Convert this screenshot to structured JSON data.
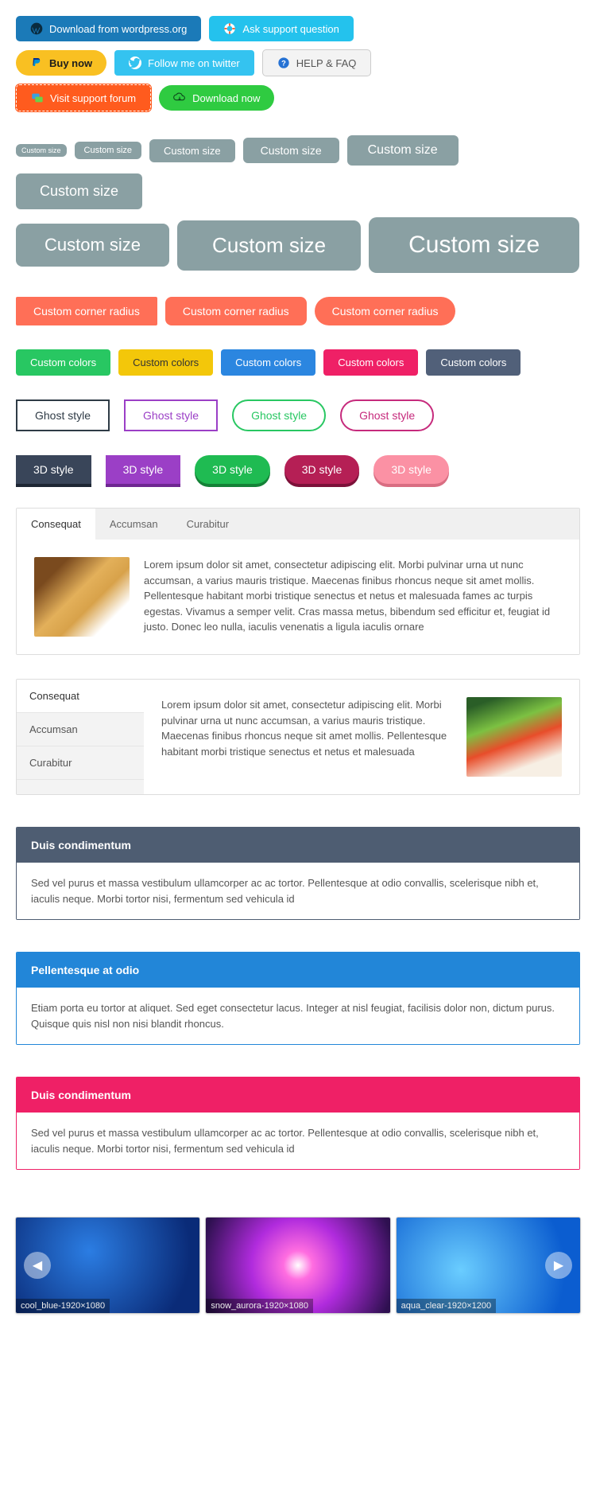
{
  "icon_buttons": {
    "wp": "Download from wordpress.org",
    "support_q": "Ask support question",
    "buy": "Buy now",
    "twitter": "Follow me on twitter",
    "help": "HELP & FAQ",
    "forum": "Visit support forum",
    "download": "Download now"
  },
  "sizes": {
    "label": "Custom size"
  },
  "radius": {
    "label": "Custom corner radius"
  },
  "colors": {
    "label": "Custom colors"
  },
  "ghost": {
    "label": "Ghost style"
  },
  "d3": {
    "label": "3D style"
  },
  "tabs_h": {
    "items": [
      "Consequat",
      "Accumsan",
      "Curabitur"
    ],
    "content": "Lorem ipsum dolor sit amet, consectetur adipiscing elit. Morbi pulvinar urna ut nunc accumsan, a varius mauris tristique. Maecenas finibus rhoncus neque sit amet mollis. Pellentesque habitant morbi tristique senectus et netus et malesuada fames ac turpis egestas. Vivamus a semper velit. Cras massa metus, bibendum sed efficitur et, feugiat id justo. Donec leo nulla, iaculis venenatis a ligula iaculis ornare"
  },
  "tabs_v": {
    "items": [
      "Consequat",
      "Accumsan",
      "Curabitur"
    ],
    "content": "Lorem ipsum dolor sit amet, consectetur adipiscing elit. Morbi pulvinar urna ut nunc accumsan, a varius mauris tristique. Maecenas finibus rhoncus neque sit amet mollis. Pellentesque habitant morbi tristique senectus et netus et malesuada"
  },
  "panels": [
    {
      "title": "Duis condimentum",
      "body": "Sed vel purus et massa vestibulum ullamcorper ac ac tortor. Pellentesque at odio convallis, scelerisque nibh et, iaculis neque. Morbi tortor nisi, fermentum sed vehicula id"
    },
    {
      "title": "Pellentesque at odio",
      "body": "Etiam porta eu tortor at aliquet. Sed eget consectetur lacus. Integer at nisl feugiat, facilisis dolor non, dictum purus. Quisque quis nisl non nisi blandit rhoncus."
    },
    {
      "title": "Duis condimentum",
      "body": "Sed vel purus et massa vestibulum ullamcorper ac ac tortor. Pellentesque at odio convallis, scelerisque nibh et, iaculis neque. Morbi tortor nisi, fermentum sed vehicula id"
    }
  ],
  "carousel": {
    "slides": [
      "cool_blue-1920×1080",
      "snow_aurora-1920×1080",
      "aqua_clear-1920×1200"
    ]
  }
}
